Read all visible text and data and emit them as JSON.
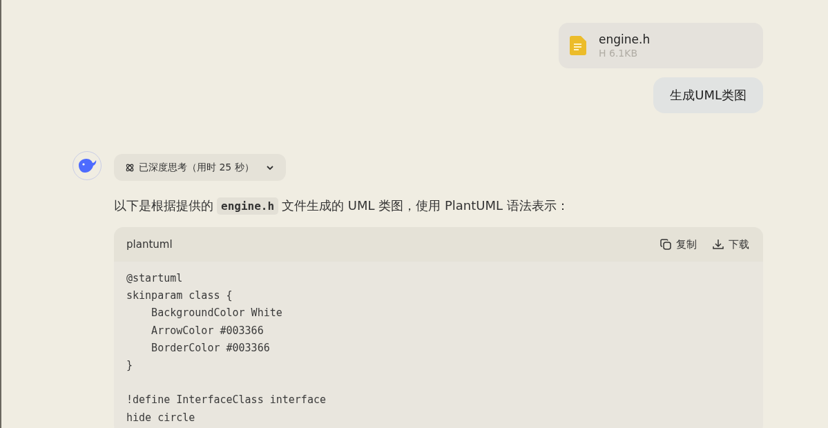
{
  "attachment": {
    "name": "engine.h",
    "meta": "H 6.1KB"
  },
  "user_message": "生成UML类图",
  "thinking": {
    "label": "已深度思考（用时 25 秒）",
    "expanded": false
  },
  "reply": {
    "before": "以下是根据提供的",
    "code": "engine.h",
    "after": "文件生成的 UML 类图，使用 PlantUML 语法表示："
  },
  "code_block": {
    "language": "plantuml",
    "actions": [
      {
        "kind": "copy",
        "label": "复制"
      },
      {
        "kind": "download",
        "label": "下载"
      }
    ],
    "sections": [
      [
        "@startuml",
        "skinparam class {",
        "    BackgroundColor White",
        "    ArrowColor #003366",
        "    BorderColor #003366",
        "}"
      ],
      [
        "!define InterfaceClass interface",
        "hide circle"
      ]
    ]
  }
}
